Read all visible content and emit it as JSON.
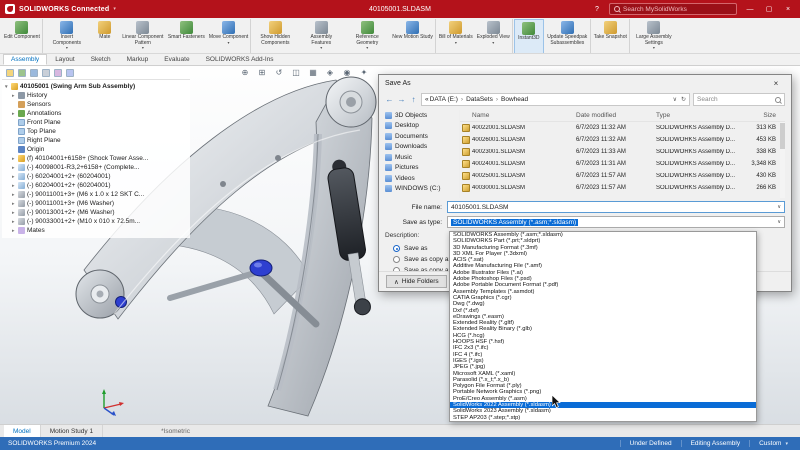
{
  "titlebar": {
    "app": "SOLIDWORKS Connected",
    "document": "40105001.SLDASM",
    "search_placeholder": "Search MySolidWorks"
  },
  "icons": {
    "back": "←",
    "forward": "→",
    "up": "↑",
    "refresh": "↻",
    "chevron_down": "∨",
    "combo_arrow": "▾",
    "menu_arrow": "▾",
    "window_min": "—",
    "window_max": "▢",
    "window_close": "×",
    "dialog_close": "×",
    "help": "?",
    "crumb_prefix": "«",
    "hide_chevron": "∧"
  },
  "ribbon": {
    "buttons": [
      {
        "label": "Edit Component",
        "sep": true
      },
      {
        "label": "Insert Components",
        "drop": true
      },
      {
        "label": "Mate"
      },
      {
        "label": "Linear Component Pattern",
        "drop": true
      },
      {
        "label": "Smart Fasteners"
      },
      {
        "label": "Move Component",
        "drop": true,
        "sep": true
      },
      {
        "label": "Show Hidden Components"
      },
      {
        "label": "Assembly Features",
        "drop": true
      },
      {
        "label": "Reference Geometry",
        "drop": true
      },
      {
        "label": "New Motion Study",
        "sep": true
      },
      {
        "label": "Bill of Materials",
        "drop": true
      },
      {
        "label": "Exploded View",
        "drop": true,
        "sep": true
      },
      {
        "label": "Instant3D",
        "active": true,
        "sep": true
      },
      {
        "label": "Update Speedpak Subassemblies",
        "sep": true
      },
      {
        "label": "Take Snapshot",
        "sep": true
      },
      {
        "label": "Large Assembly Settings",
        "drop": true
      }
    ],
    "tabs": [
      {
        "label": "Assembly",
        "active": true
      },
      {
        "label": "Layout"
      },
      {
        "label": "Sketch"
      },
      {
        "label": "Markup"
      },
      {
        "label": "Evaluate"
      },
      {
        "label": "SOLIDWORKS Add-Ins"
      }
    ]
  },
  "feature_tree": {
    "root": {
      "exp": "▾",
      "label": "40105001 (Swing Arm Sub Assembly)"
    },
    "items": [
      {
        "exp": "▸",
        "icon": "history-icon",
        "label": "History"
      },
      {
        "exp": "",
        "icon": "sensors-icon",
        "label": "Sensors"
      },
      {
        "exp": "▸",
        "icon": "annotations-icon",
        "label": "Annotations"
      },
      {
        "exp": "",
        "icon": "plane-icon",
        "label": "Front Plane"
      },
      {
        "exp": "",
        "icon": "plane-icon",
        "label": "Top Plane"
      },
      {
        "exp": "",
        "icon": "plane-icon",
        "label": "Right Plane"
      },
      {
        "exp": "",
        "icon": "origin-icon",
        "label": "Origin"
      },
      {
        "exp": "▸",
        "icon": "assembly-icon",
        "label": "(f) 40104001+6158+ (Shock Tower Asse..."
      },
      {
        "exp": "▸",
        "icon": "part-icon",
        "label": "(-) 40098001-R3,2+6158+ (Complete..."
      },
      {
        "exp": "▸",
        "icon": "part-icon",
        "label": "(-) 60204001+2+ (60204001)"
      },
      {
        "exp": "▸",
        "icon": "part-icon",
        "label": "(-) 60204001+2+ (60204001)"
      },
      {
        "exp": "▸",
        "icon": "fastener-icon",
        "label": "(-) 90011001+3+ (M6 x 1.0 x 12 SKT C..."
      },
      {
        "exp": "▸",
        "icon": "fastener-icon",
        "label": "(-) 90011001+3+ (M6 Washer)"
      },
      {
        "exp": "▸",
        "icon": "fastener-icon",
        "label": "(-) 90013001+2+ (M6 Washer)"
      },
      {
        "exp": "▸",
        "icon": "fastener-icon",
        "label": "(-) 90033001+2+ (M10 x 010 x 72.5m..."
      },
      {
        "exp": "▸",
        "icon": "mates-icon",
        "label": "Mates"
      }
    ]
  },
  "viewport": {
    "view_label": "*Isometric",
    "headsup": [
      {
        "name": "zoom-fit-icon",
        "glyph": "⊕"
      },
      {
        "name": "zoom-area-icon",
        "glyph": "⊞"
      },
      {
        "name": "previous-view-icon",
        "glyph": "↺"
      },
      {
        "name": "section-view-icon",
        "glyph": "◫"
      },
      {
        "name": "view-orientation-icon",
        "glyph": "▦"
      },
      {
        "name": "display-style-icon",
        "glyph": "◈"
      },
      {
        "name": "hide-show-icon",
        "glyph": "◉"
      },
      {
        "name": "appearance-icon",
        "glyph": "✦"
      }
    ]
  },
  "save_dialog": {
    "title": "Save As",
    "crumbs": [
      "DATA (E:)",
      "DataSets",
      "Bowhead"
    ],
    "search_placeholder": "Search",
    "columns": [
      "Name",
      "Date modified",
      "Type",
      "Size"
    ],
    "sidebar": [
      "3D Objects",
      "Desktop",
      "Documents",
      "Downloads",
      "Music",
      "Pictures",
      "Videos",
      "WINDOWS (C:)"
    ],
    "files": [
      {
        "name": "40022001.SLDASM",
        "date": "6/7/2023 11:32 AM",
        "type": "SOLIDWORKS Assembly D...",
        "size": "313 KB"
      },
      {
        "name": "40026001.SLDASM",
        "date": "6/7/2023 11:32 AM",
        "type": "SOLIDWORKS Assembly D...",
        "size": "453 KB"
      },
      {
        "name": "40023001.SLDASM",
        "date": "6/7/2023 11:33 AM",
        "type": "SOLIDWORKS Assembly D...",
        "size": "338 KB"
      },
      {
        "name": "40024001.SLDASM",
        "date": "6/7/2023 11:31 AM",
        "type": "SOLIDWORKS Assembly D...",
        "size": "3,348 KB"
      },
      {
        "name": "40025001.SLDASM",
        "date": "6/7/2023 11:57 AM",
        "type": "SOLIDWORKS Assembly D...",
        "size": "430 KB"
      },
      {
        "name": "40030001.SLDASM",
        "date": "6/7/2023 11:57 AM",
        "type": "SOLIDWORKS Assembly D...",
        "size": "266 KB"
      }
    ],
    "file_name_label": "File name:",
    "file_name": "40105001.SLDASM",
    "save_type_label": "Save as type:",
    "save_type_value": "SOLIDWORKS Assembly (*.asm;*.sldasm)",
    "description_label": "Description:",
    "options": [
      {
        "label": "Save as",
        "checked": true
      },
      {
        "label": "Save as copy and continue"
      },
      {
        "label": "Save as copy and open"
      }
    ],
    "hide_folders_label": "Hide Folders",
    "type_options": [
      {
        "label": "SOLIDWORKS Assembly (*.asm;*.sldasm)"
      },
      {
        "label": "SOLIDWORKS Part (*.prt;*.sldprt)"
      },
      {
        "label": "3D Manufacturing Format (*.3mf)"
      },
      {
        "label": "3D XML For Player (*.3dxml)"
      },
      {
        "label": "ACIS (*.sat)"
      },
      {
        "label": "Additive Manufacturing File (*.amf)"
      },
      {
        "label": "Adobe Illustrator Files (*.ai)"
      },
      {
        "label": "Adobe Photoshop Files (*.psd)"
      },
      {
        "label": "Adobe Portable Document Format (*.pdf)"
      },
      {
        "label": "Assembly Templates (*.asmdot)"
      },
      {
        "label": "CATIA Graphics (*.cgr)"
      },
      {
        "label": "Dwg (*.dwg)"
      },
      {
        "label": "Dxf (*.dxf)"
      },
      {
        "label": "eDrawings (*.easm)"
      },
      {
        "label": "Extended Reality (*.gltf)"
      },
      {
        "label": "Extended Reality Binary (*.glb)"
      },
      {
        "label": "HCG (*.hcg)"
      },
      {
        "label": "HOOPS HSF (*.hsf)"
      },
      {
        "label": "IFC 2x3 (*.ifc)"
      },
      {
        "label": "IFC 4 (*.ifc)"
      },
      {
        "label": "IGES (*.igs)"
      },
      {
        "label": "JPEG (*.jpg)"
      },
      {
        "label": "Microsoft XAML (*.xaml)"
      },
      {
        "label": "Parasolid (*.x_t;*.x_b)"
      },
      {
        "label": "Polygon File Format (*.ply)"
      },
      {
        "label": "Portable Network Graphics (*.png)"
      },
      {
        "label": "ProE/Creo Assembly (*.asm)"
      },
      {
        "label": "SolidWorks 2022 Assembly (*.sldasm)",
        "selected": true
      },
      {
        "label": "SolidWorks 2023 Assembly (*.sldasm)"
      },
      {
        "label": "STEP AP203 (*.step;*.stp)"
      }
    ]
  },
  "bottom": {
    "tabs": [
      {
        "label": "Model",
        "active": true
      },
      {
        "label": "Motion Study 1"
      }
    ]
  },
  "statusbar": {
    "left": "SOLIDWORKS Premium 2024",
    "items": [
      "Under Defined",
      "Editing Assembly"
    ],
    "custom_label": "Custom"
  }
}
